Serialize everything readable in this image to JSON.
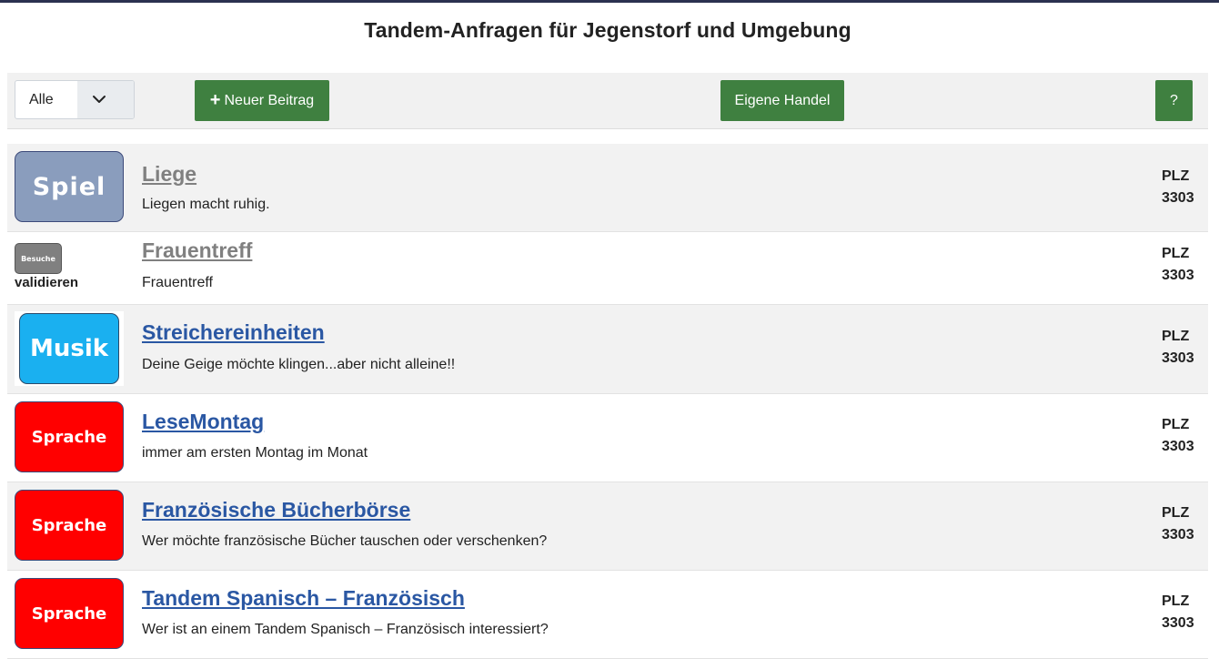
{
  "page": {
    "title": "Tandem-Anfragen für Jegenstorf und Umgebung"
  },
  "toolbar": {
    "filter_value": "Alle",
    "new_post_label": "Neuer Beitrag",
    "own_trade_label": "Eigene Handel",
    "help_label": "?"
  },
  "colors": {
    "button_green": "#3f8040",
    "link_blue": "#2a57a3",
    "link_grey": "#808080",
    "sprache_red": "#ff0000",
    "musik_blue": "#1ab0f0",
    "spiel_blue": "#8a9dbd"
  },
  "rows": [
    {
      "thumb_label": "Spiel",
      "title": "Liege",
      "description": "Liegen macht ruhig.",
      "plz_label": "PLZ",
      "plz": "3303"
    },
    {
      "thumb_label": "Besuche",
      "badge": "validieren",
      "title": "Frauentreff",
      "description": "Frauentreff",
      "plz_label": "PLZ",
      "plz": "3303"
    },
    {
      "thumb_label": "Musik",
      "title": "Streichereinheiten",
      "description": "Deine Geige möchte klingen...aber nicht alleine!!",
      "plz_label": "PLZ",
      "plz": "3303"
    },
    {
      "thumb_label": "Sprache",
      "title": "LeseMontag",
      "description": "immer am ersten Montag im Monat",
      "plz_label": "PLZ",
      "plz": "3303"
    },
    {
      "thumb_label": "Sprache",
      "title": "Französische Bücherbörse",
      "description": "Wer möchte französische Bücher tauschen oder verschenken?",
      "plz_label": "PLZ",
      "plz": "3303"
    },
    {
      "thumb_label": "Sprache",
      "title": "Tandem Spanisch – Französisch",
      "description": "Wer ist an einem Tandem Spanisch – Französisch interessiert?",
      "plz_label": "PLZ",
      "plz": "3303"
    }
  ]
}
